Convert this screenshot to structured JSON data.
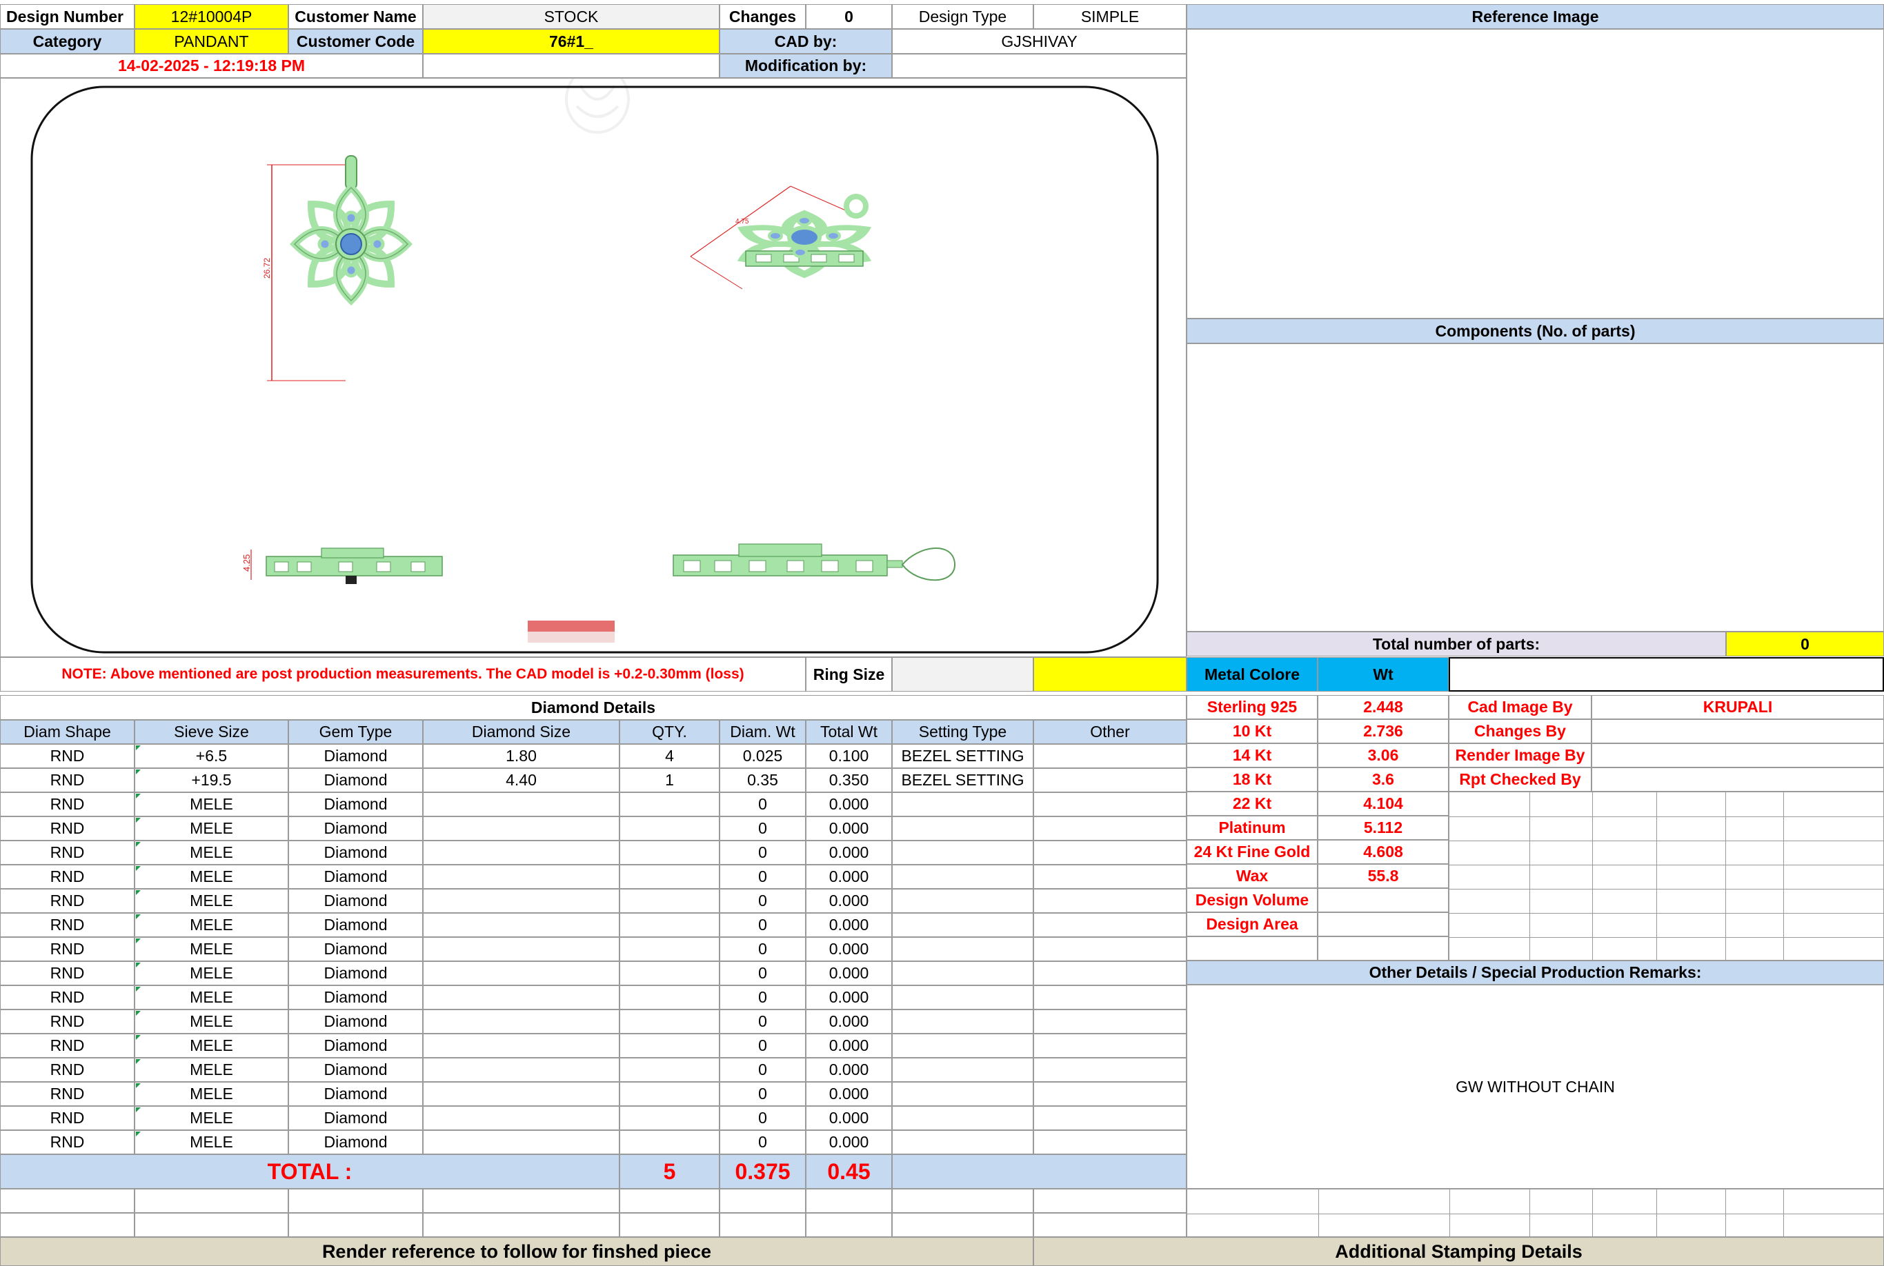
{
  "header": {
    "design_number_label": "Design Number",
    "design_number": "12#10004P",
    "customer_name_label": "Customer Name",
    "customer_name": "STOCK",
    "changes_label": "Changes",
    "changes_value": "0",
    "design_type_label": "Design Type",
    "design_type": "SIMPLE",
    "reference_image_label": "Reference Image",
    "category_label": "Category",
    "category": "PANDANT",
    "customer_code_label": "Customer Code",
    "customer_code": "76#1_",
    "cad_by_label": "CAD by:",
    "cad_by": "GJSHIVAY",
    "timestamp": "14-02-2025 - 12:19:18 PM",
    "modification_by_label": "Modification by:"
  },
  "drawing": {
    "dim_height": "26.72",
    "dim_side": "4.25",
    "dim_angle": "4.75"
  },
  "components_label": "Components (No. of parts)",
  "total_parts_label": "Total number of parts:",
  "total_parts_value": "0",
  "note": "NOTE: Above mentioned are post production measurements. The CAD model is +0.2-0.30mm (loss)",
  "ring_size_label": "Ring Size",
  "diamond": {
    "section_title": "Diamond Details",
    "columns": [
      "Diam Shape",
      "Sieve Size",
      "Gem Type",
      "Diamond Size",
      "QTY.",
      "Diam. Wt",
      "Total Wt",
      "Setting Type",
      "Other"
    ],
    "rows": [
      [
        "RND",
        "+6.5",
        "Diamond",
        "1.80",
        "4",
        "0.025",
        "0.100",
        "BEZEL SETTING",
        ""
      ],
      [
        "RND",
        "+19.5",
        "Diamond",
        "4.40",
        "1",
        "0.35",
        "0.350",
        "BEZEL SETTING",
        ""
      ],
      [
        "RND",
        "MELE",
        "Diamond",
        "",
        "",
        "0",
        "0.000",
        "",
        ""
      ],
      [
        "RND",
        "MELE",
        "Diamond",
        "",
        "",
        "0",
        "0.000",
        "",
        ""
      ],
      [
        "RND",
        "MELE",
        "Diamond",
        "",
        "",
        "0",
        "0.000",
        "",
        ""
      ],
      [
        "RND",
        "MELE",
        "Diamond",
        "",
        "",
        "0",
        "0.000",
        "",
        ""
      ],
      [
        "RND",
        "MELE",
        "Diamond",
        "",
        "",
        "0",
        "0.000",
        "",
        ""
      ],
      [
        "RND",
        "MELE",
        "Diamond",
        "",
        "",
        "0",
        "0.000",
        "",
        ""
      ],
      [
        "RND",
        "MELE",
        "Diamond",
        "",
        "",
        "0",
        "0.000",
        "",
        ""
      ],
      [
        "RND",
        "MELE",
        "Diamond",
        "",
        "",
        "0",
        "0.000",
        "",
        ""
      ],
      [
        "RND",
        "MELE",
        "Diamond",
        "",
        "",
        "0",
        "0.000",
        "",
        ""
      ],
      [
        "RND",
        "MELE",
        "Diamond",
        "",
        "",
        "0",
        "0.000",
        "",
        ""
      ],
      [
        "RND",
        "MELE",
        "Diamond",
        "",
        "",
        "0",
        "0.000",
        "",
        ""
      ],
      [
        "RND",
        "MELE",
        "Diamond",
        "",
        "",
        "0",
        "0.000",
        "",
        ""
      ],
      [
        "RND",
        "MELE",
        "Diamond",
        "",
        "",
        "0",
        "0.000",
        "",
        ""
      ],
      [
        "RND",
        "MELE",
        "Diamond",
        "",
        "",
        "0",
        "0.000",
        "",
        ""
      ],
      [
        "RND",
        "MELE",
        "Diamond",
        "",
        "",
        "0",
        "0.000",
        "",
        ""
      ]
    ],
    "total_label": "TOTAL :",
    "total_qty": "5",
    "total_diam_wt": "0.375",
    "total_wt": "0.45"
  },
  "metal": {
    "color_label": "Metal Colore",
    "wt_label": "Wt",
    "rows": [
      [
        "Sterling 925",
        "2.448"
      ],
      [
        "10 Kt",
        "2.736"
      ],
      [
        "14 Kt",
        "3.06"
      ],
      [
        "18 Kt",
        "3.6"
      ],
      [
        "22 Kt",
        "4.104"
      ],
      [
        "Platinum",
        "5.112"
      ],
      [
        "24 Kt Fine Gold",
        "4.608"
      ],
      [
        "Wax",
        "55.8"
      ],
      [
        "Design Volume",
        ""
      ],
      [
        "Design Area",
        ""
      ]
    ]
  },
  "credits": {
    "cad_image_by_label": "Cad Image By",
    "cad_image_by": "KRUPALI",
    "changes_by_label": "Changes By",
    "render_image_by_label": "Render Image By",
    "rpt_checked_by_label": "Rpt Checked By"
  },
  "other_details_label": "Other Details / Special Production Remarks:",
  "remarks": "GW WITHOUT CHAIN",
  "footer": {
    "render_reference": "Render reference to follow for finshed piece",
    "stamping": "Additional Stamping Details"
  },
  "colors": {
    "yellow": "#ffff00",
    "light_blue": "#c5d9f1",
    "cyan": "#00b0f0",
    "red": "#ff0000",
    "metal_green": "#a6e3a6",
    "gem_blue": "#5a8fd6"
  }
}
